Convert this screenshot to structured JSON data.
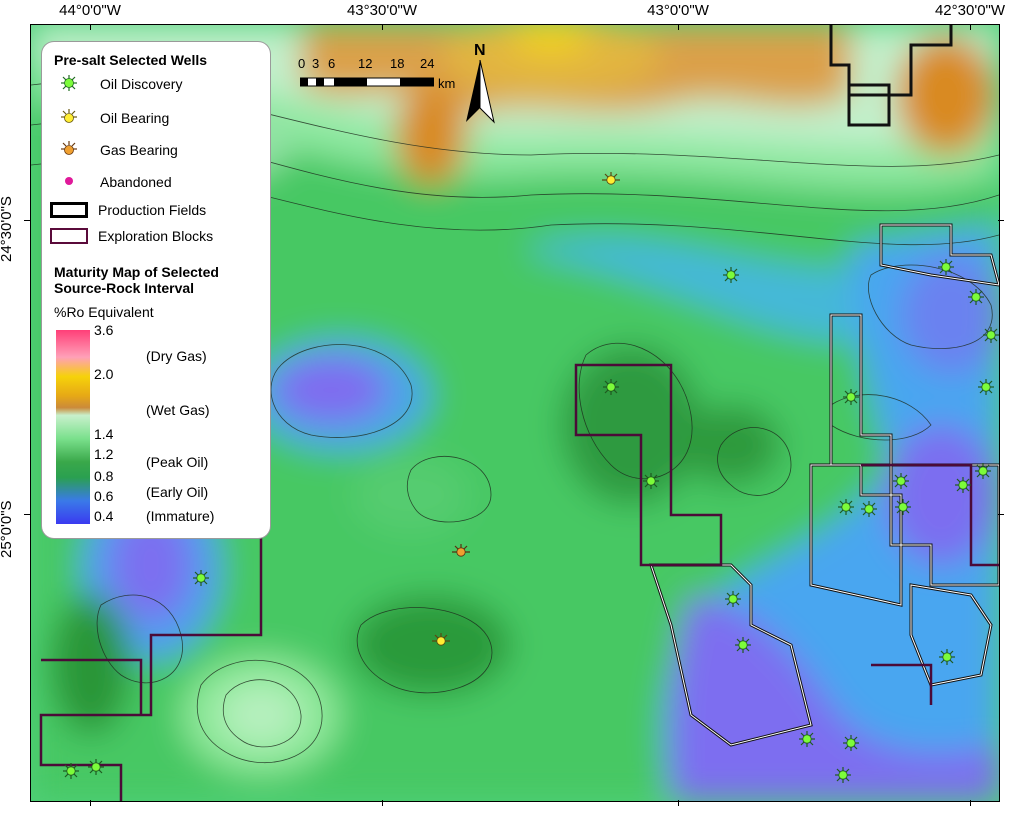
{
  "coordinates": {
    "top": [
      "44°0'0\"W",
      "43°30'0\"W",
      "43°0'0\"W",
      "42°30'0\"W"
    ],
    "left": [
      "24°30'0\"S",
      "25°0'0\"S"
    ]
  },
  "legend": {
    "wells_title": "Pre-salt Selected Wells",
    "wells": [
      {
        "label": "Oil Discovery",
        "icon": "oil-discovery-icon",
        "color": "#7cfc3a"
      },
      {
        "label": "Oil Bearing",
        "icon": "oil-bearing-icon",
        "color": "#ffee33"
      },
      {
        "label": "Gas Bearing",
        "icon": "gas-bearing-icon",
        "color": "#f0a030"
      },
      {
        "label": "Abandoned",
        "icon": "abandoned-icon",
        "color": "#e0199a"
      }
    ],
    "areas": [
      {
        "label": "Production Fields",
        "border": "#000000"
      },
      {
        "label": "Exploration Blocks",
        "border": "#5a0a3a"
      }
    ],
    "maturity_title_line1": "Maturity Map of Selected",
    "maturity_title_line2": "Source-Rock Interval",
    "unit": "%Ro Equivalent",
    "ramp_values": [
      "3.6",
      "2.0",
      "1.4",
      "1.2",
      "0.8",
      "0.6",
      "0.4"
    ],
    "classes": [
      "(Dry Gas)",
      "(Wet Gas)",
      "(Peak Oil)",
      "(Early Oil)",
      "(Immature)"
    ]
  },
  "scale": {
    "ticks": [
      "0",
      "3",
      "6",
      "12",
      "18",
      "24"
    ],
    "unit": "km"
  },
  "north_label": "N",
  "colors": {
    "immature": "#7b6cf0",
    "early_oil_low": "#3aa4f0",
    "early_oil": "#3cb44a",
    "peak_oil": "#6fe08a",
    "peak_oil_high": "#c9f5d2",
    "wet_gas": "#d8891c",
    "wet_gas_high": "#f6d20a",
    "dry_gas": "#ff3f6e"
  }
}
